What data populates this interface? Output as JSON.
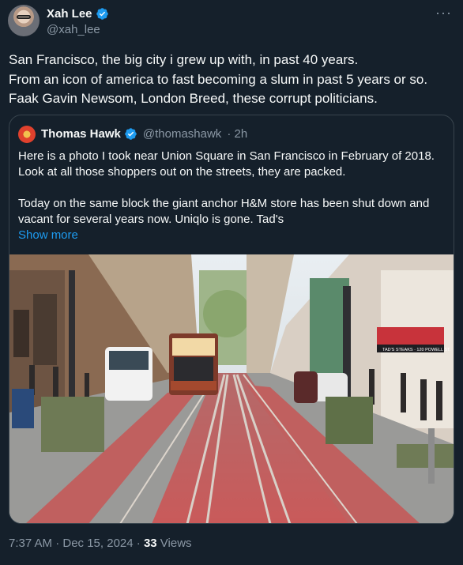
{
  "author": {
    "name": "Xah Lee",
    "handle": "@xah_lee",
    "verified_icon": "verified-badge-icon"
  },
  "menu_icon": "more-dots-icon",
  "text_lines": [
    "San Francisco, the big city i grew up with, in past 40 years.",
    "From an icon of america to fast becoming a slum in past 5 years or so.",
    "Faak Gavin Newsom, London Breed, these corrupt politicians."
  ],
  "quote": {
    "name": "Thomas Hawk",
    "handle": "@thomashawk",
    "time": "· 2h",
    "lines_a": [
      "Here is a photo I took near Union Square in San Francisco in February of 2018.",
      "Look at all those shoppers out on the streets, they are packed."
    ],
    "lines_b": [
      "Today on the same block the giant anchor H&M store has been shut down and",
      "vacant for several years now.  Uniqlo is gone.  Tad's"
    ],
    "show_more": "Show more",
    "image_store_sign": "TAD'S STEAKS · 120 POWELL ST."
  },
  "footer": {
    "time": "7:37 AM · Dec 15, 2024 · ",
    "views_count": "33",
    "views_label": " Views"
  },
  "colors": {
    "background": "#15202b",
    "text": "#f7f9f9",
    "secondary": "#8b98a5",
    "link": "#1d9bf0",
    "border": "#38444d"
  }
}
